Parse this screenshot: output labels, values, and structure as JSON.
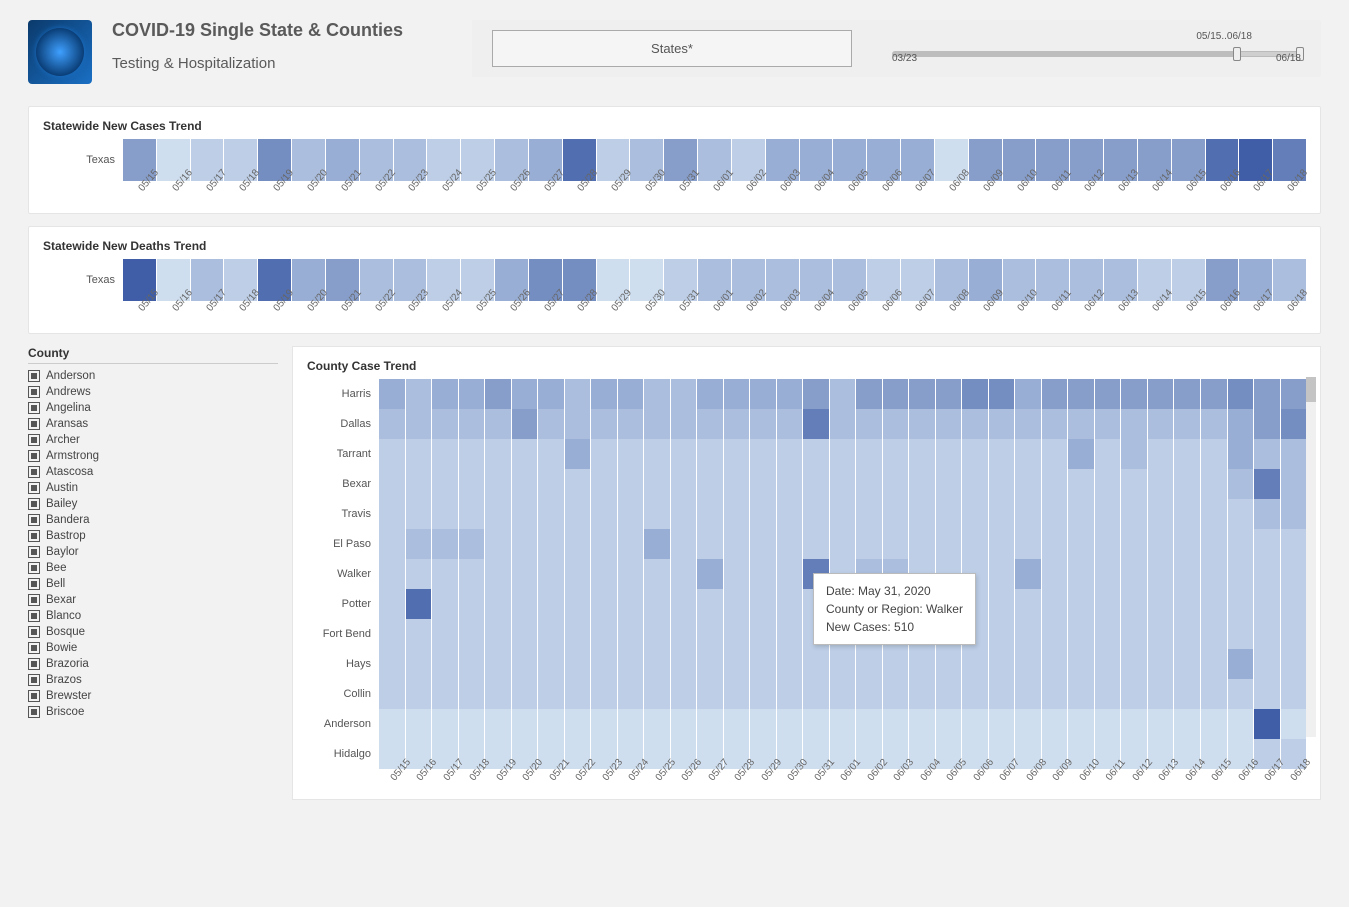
{
  "header": {
    "title": "COVID-19 Single State & Counties",
    "subtitle": "Testing & Hospitalization",
    "states_button": "States*",
    "slider": {
      "range_label": "05/15..06/18",
      "min_label": "03/23",
      "max_label": "06/18"
    }
  },
  "dates": [
    "05/15",
    "05/16",
    "05/17",
    "05/18",
    "05/19",
    "05/20",
    "05/21",
    "05/22",
    "05/23",
    "05/24",
    "05/25",
    "05/26",
    "05/27",
    "05/28",
    "05/29",
    "05/30",
    "05/31",
    "06/01",
    "06/02",
    "06/03",
    "06/04",
    "06/05",
    "06/06",
    "06/07",
    "06/08",
    "06/09",
    "06/10",
    "06/11",
    "06/12",
    "06/13",
    "06/14",
    "06/15",
    "06/16",
    "06/17",
    "06/18"
  ],
  "panels": {
    "cases_title": "Statewide New Cases Trend",
    "deaths_title": "Statewide New Deaths Trend",
    "county_title": "County Case Trend",
    "row_label": "Texas"
  },
  "counties_filter": {
    "title": "County",
    "items": [
      "Anderson",
      "Andrews",
      "Angelina",
      "Aransas",
      "Archer",
      "Armstrong",
      "Atascosa",
      "Austin",
      "Bailey",
      "Bandera",
      "Bastrop",
      "Baylor",
      "Bee",
      "Bell",
      "Bexar",
      "Blanco",
      "Bosque",
      "Bowie",
      "Brazoria",
      "Brazos",
      "Brewster",
      "Briscoe"
    ]
  },
  "county_rows": [
    "Harris",
    "Dallas",
    "Tarrant",
    "Bexar",
    "Travis",
    "El Paso",
    "Walker",
    "Potter",
    "Fort Bend",
    "Hays",
    "Collin",
    "Anderson",
    "Hidalgo"
  ],
  "tooltip": {
    "line1": "Date: May 31, 2020",
    "line2": "County or Region: Walker",
    "line3": "New Cases:  510"
  },
  "chart_data": [
    {
      "type": "heatmap",
      "title": "Statewide New Cases Trend",
      "y_categories": [
        "Texas"
      ],
      "x_categories": [
        "05/15",
        "05/16",
        "05/17",
        "05/18",
        "05/19",
        "05/20",
        "05/21",
        "05/22",
        "05/23",
        "05/24",
        "05/25",
        "05/26",
        "05/27",
        "05/28",
        "05/29",
        "05/30",
        "05/31",
        "06/01",
        "06/02",
        "06/03",
        "06/04",
        "06/05",
        "06/06",
        "06/07",
        "06/08",
        "06/09",
        "06/10",
        "06/11",
        "06/12",
        "06/13",
        "06/14",
        "06/15",
        "06/16",
        "06/17",
        "06/18"
      ],
      "note": "Values are relative intensity estimates (0–10 scale) read from color",
      "values": [
        [
          5,
          1,
          2,
          2,
          6,
          3,
          4,
          3,
          3,
          2,
          2,
          3,
          4,
          8,
          2,
          3,
          5,
          3,
          2,
          4,
          4,
          4,
          4,
          4,
          1,
          5,
          5,
          5,
          5,
          5,
          5,
          5,
          8,
          9,
          7
        ]
      ]
    },
    {
      "type": "heatmap",
      "title": "Statewide New Deaths Trend",
      "y_categories": [
        "Texas"
      ],
      "x_categories": [
        "05/15",
        "05/16",
        "05/17",
        "05/18",
        "05/19",
        "05/20",
        "05/21",
        "05/22",
        "05/23",
        "05/24",
        "05/25",
        "05/26",
        "05/27",
        "05/28",
        "05/29",
        "05/30",
        "05/31",
        "06/01",
        "06/02",
        "06/03",
        "06/04",
        "06/05",
        "06/06",
        "06/07",
        "06/08",
        "06/09",
        "06/10",
        "06/11",
        "06/12",
        "06/13",
        "06/14",
        "06/15",
        "06/16",
        "06/17",
        "06/18"
      ],
      "note": "Values are relative intensity estimates (0–10 scale) read from color",
      "values": [
        [
          9,
          1,
          3,
          2,
          8,
          4,
          5,
          3,
          3,
          2,
          2,
          4,
          6,
          6,
          1,
          1,
          2,
          3,
          3,
          3,
          3,
          3,
          2,
          2,
          3,
          4,
          3,
          3,
          3,
          3,
          2,
          2,
          5,
          4,
          3
        ]
      ]
    },
    {
      "type": "heatmap",
      "title": "County Case Trend",
      "y_categories": [
        "Harris",
        "Dallas",
        "Tarrant",
        "Bexar",
        "Travis",
        "El Paso",
        "Walker",
        "Potter",
        "Fort Bend",
        "Hays",
        "Collin",
        "Anderson",
        "Hidalgo"
      ],
      "x_categories": [
        "05/15",
        "05/16",
        "05/17",
        "05/18",
        "05/19",
        "05/20",
        "05/21",
        "05/22",
        "05/23",
        "05/24",
        "05/25",
        "05/26",
        "05/27",
        "05/28",
        "05/29",
        "05/30",
        "05/31",
        "06/01",
        "06/02",
        "06/03",
        "06/04",
        "06/05",
        "06/06",
        "06/07",
        "06/08",
        "06/09",
        "06/10",
        "06/11",
        "06/12",
        "06/13",
        "06/14",
        "06/15",
        "06/16",
        "06/17",
        "06/18"
      ],
      "note": "Values are relative intensity estimates (0–10 scale) read from color; Walker on 05/31 = 510 new cases (from tooltip)",
      "values": [
        [
          4,
          3,
          4,
          4,
          5,
          4,
          4,
          3,
          4,
          4,
          3,
          3,
          4,
          4,
          4,
          4,
          5,
          3,
          5,
          5,
          5,
          5,
          6,
          6,
          4,
          5,
          5,
          5,
          5,
          5,
          5,
          5,
          6,
          5,
          5
        ],
        [
          3,
          3,
          3,
          3,
          3,
          5,
          3,
          3,
          3,
          3,
          3,
          3,
          3,
          3,
          3,
          3,
          7,
          3,
          3,
          3,
          3,
          3,
          3,
          3,
          3,
          3,
          3,
          3,
          3,
          3,
          3,
          3,
          4,
          5,
          6
        ],
        [
          2,
          2,
          2,
          2,
          2,
          2,
          2,
          4,
          2,
          2,
          2,
          2,
          2,
          2,
          2,
          2,
          2,
          2,
          2,
          2,
          2,
          2,
          2,
          2,
          2,
          2,
          4,
          2,
          3,
          2,
          2,
          2,
          4,
          3,
          3
        ],
        [
          2,
          2,
          2,
          2,
          2,
          2,
          2,
          2,
          2,
          2,
          2,
          2,
          2,
          2,
          2,
          2,
          2,
          2,
          2,
          2,
          2,
          2,
          2,
          2,
          2,
          2,
          2,
          2,
          2,
          2,
          2,
          2,
          3,
          7,
          3
        ],
        [
          2,
          2,
          2,
          2,
          2,
          2,
          2,
          2,
          2,
          2,
          2,
          2,
          2,
          2,
          2,
          2,
          2,
          2,
          2,
          2,
          2,
          2,
          2,
          2,
          2,
          2,
          2,
          2,
          2,
          2,
          2,
          2,
          2,
          3,
          3
        ],
        [
          2,
          3,
          3,
          3,
          2,
          2,
          2,
          2,
          2,
          2,
          4,
          2,
          2,
          2,
          2,
          2,
          2,
          2,
          2,
          2,
          2,
          2,
          2,
          2,
          2,
          2,
          2,
          2,
          2,
          2,
          2,
          2,
          2,
          2,
          2
        ],
        [
          2,
          2,
          2,
          2,
          2,
          2,
          2,
          2,
          2,
          2,
          2,
          2,
          4,
          2,
          2,
          2,
          7,
          2,
          3,
          3,
          2,
          2,
          2,
          2,
          4,
          2,
          2,
          2,
          2,
          2,
          2,
          2,
          2,
          2,
          2
        ],
        [
          2,
          8,
          2,
          2,
          2,
          2,
          2,
          2,
          2,
          2,
          2,
          2,
          2,
          2,
          2,
          2,
          2,
          2,
          2,
          2,
          2,
          2,
          2,
          2,
          2,
          2,
          2,
          2,
          2,
          2,
          2,
          2,
          2,
          2,
          2
        ],
        [
          2,
          2,
          2,
          2,
          2,
          2,
          2,
          2,
          2,
          2,
          2,
          2,
          2,
          2,
          2,
          2,
          2,
          2,
          2,
          2,
          2,
          2,
          2,
          2,
          2,
          2,
          2,
          2,
          2,
          2,
          2,
          2,
          2,
          2,
          2
        ],
        [
          2,
          2,
          2,
          2,
          2,
          2,
          2,
          2,
          2,
          2,
          2,
          2,
          2,
          2,
          2,
          2,
          2,
          2,
          2,
          2,
          2,
          2,
          2,
          2,
          2,
          2,
          2,
          2,
          2,
          2,
          2,
          2,
          4,
          2,
          2
        ],
        [
          2,
          2,
          2,
          2,
          2,
          2,
          2,
          2,
          2,
          2,
          2,
          2,
          2,
          2,
          2,
          2,
          2,
          2,
          2,
          2,
          2,
          2,
          2,
          2,
          2,
          2,
          2,
          2,
          2,
          2,
          2,
          2,
          2,
          2,
          2
        ],
        [
          1,
          1,
          1,
          1,
          1,
          1,
          1,
          1,
          1,
          1,
          1,
          1,
          1,
          1,
          1,
          1,
          1,
          1,
          1,
          1,
          1,
          1,
          1,
          1,
          1,
          1,
          1,
          1,
          1,
          1,
          1,
          1,
          1,
          9,
          1
        ],
        [
          1,
          1,
          1,
          1,
          1,
          1,
          1,
          1,
          1,
          1,
          1,
          1,
          1,
          1,
          1,
          1,
          1,
          1,
          1,
          1,
          1,
          1,
          1,
          1,
          1,
          1,
          1,
          1,
          1,
          1,
          1,
          1,
          1,
          2,
          2
        ]
      ]
    }
  ]
}
